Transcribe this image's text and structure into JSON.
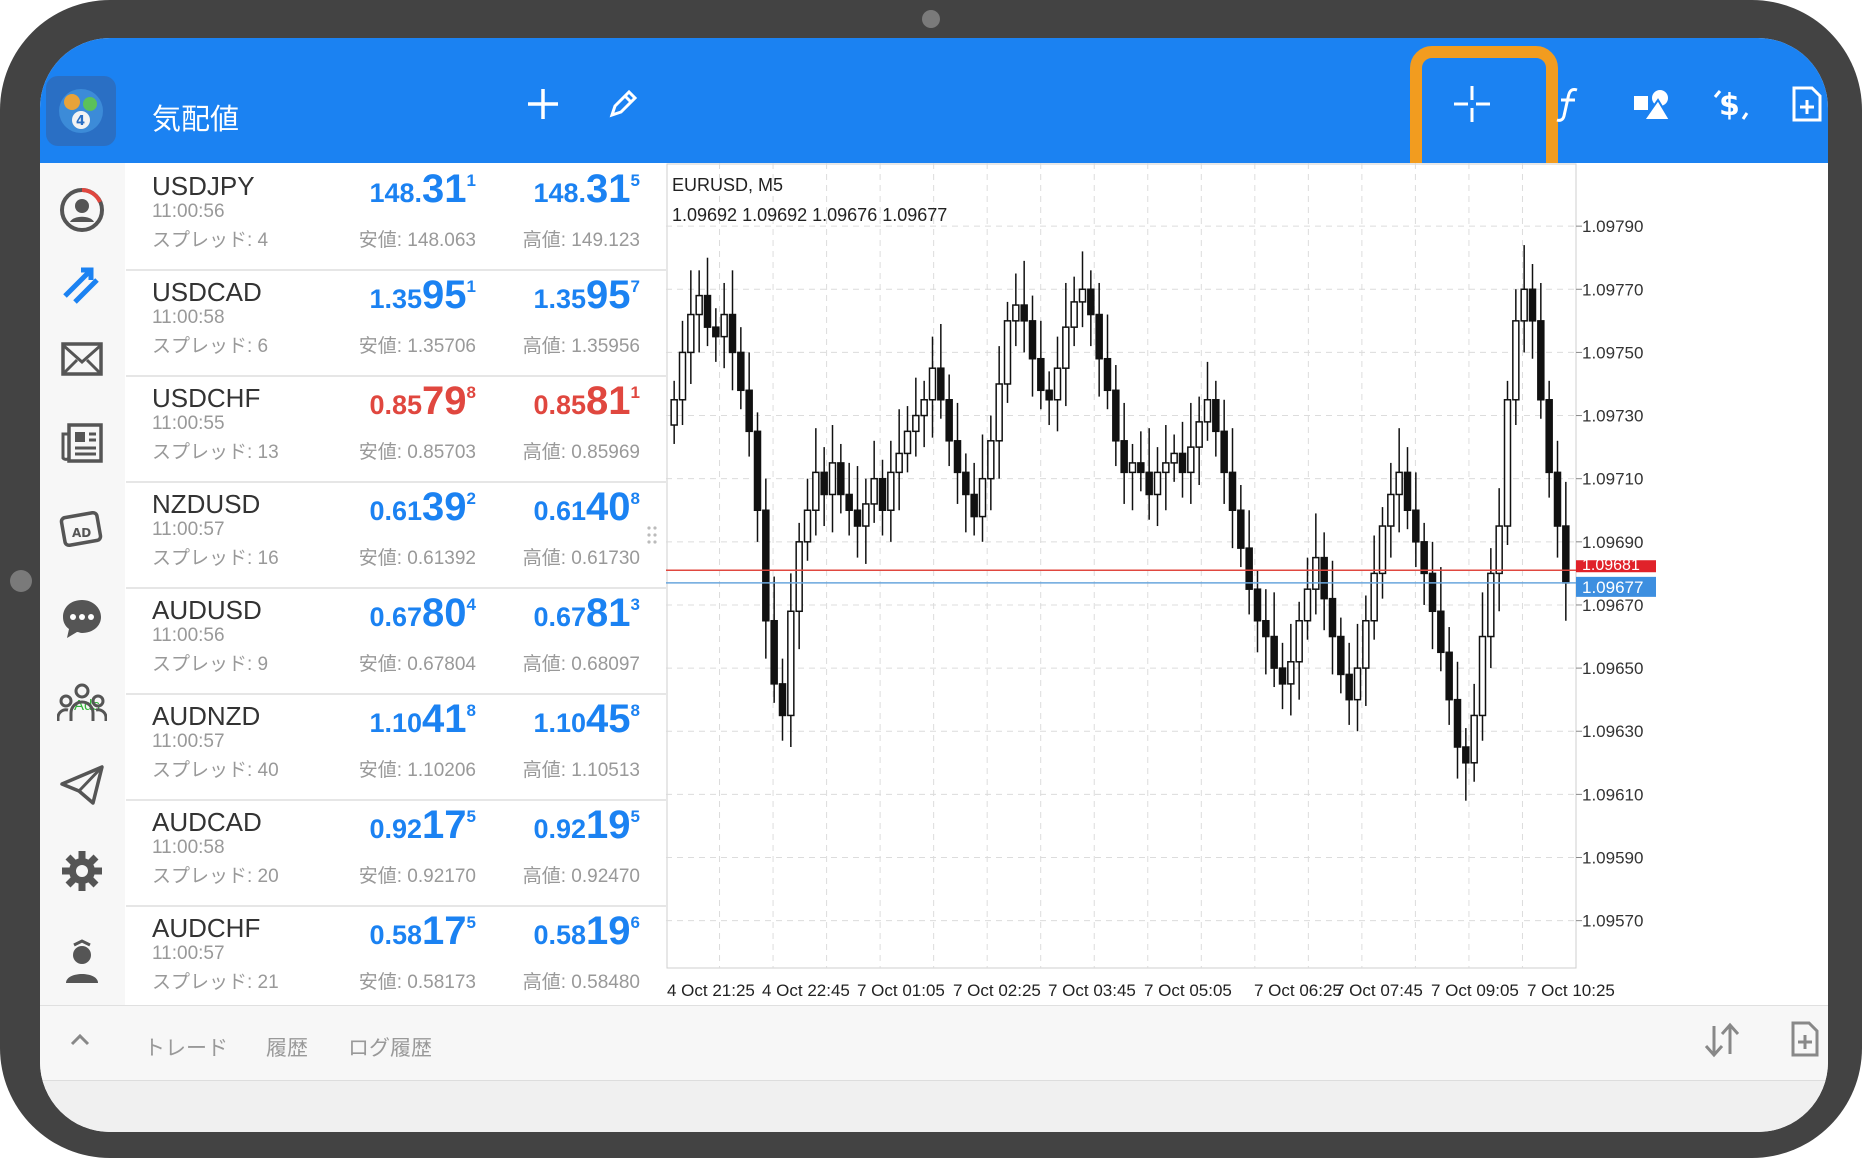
{
  "app": {
    "title": "気配値"
  },
  "toolbar": {
    "icons": [
      "plus-icon",
      "pencil-icon",
      "crosshair-icon",
      "function-icon",
      "shapes-icon",
      "dollar-signal-icon",
      "new-order-icon"
    ]
  },
  "sidebar": {
    "icons": [
      "account-icon",
      "trade-icon",
      "mail-icon",
      "news-icon",
      "ads-icon",
      "chat-icon",
      "community-icon",
      "telegram-icon",
      "settings-icon",
      "traders-icon"
    ],
    "ads_label": "Ads"
  },
  "quotes": [
    {
      "symbol": "USDJPY",
      "time": "11:00:56",
      "spread": "スプレッド: 4",
      "bid": {
        "prefix": "148.",
        "big": "31",
        "sup": "1"
      },
      "ask": {
        "prefix": "148.",
        "big": "31",
        "sup": "5"
      },
      "low": "安値: 148.063",
      "high": "高値: 149.123",
      "color": "blue"
    },
    {
      "symbol": "USDCAD",
      "time": "11:00:58",
      "spread": "スプレッド: 6",
      "bid": {
        "prefix": "1.35",
        "big": "95",
        "sup": "1"
      },
      "ask": {
        "prefix": "1.35",
        "big": "95",
        "sup": "7"
      },
      "low": "安値: 1.35706",
      "high": "高値: 1.35956",
      "color": "blue"
    },
    {
      "symbol": "USDCHF",
      "time": "11:00:55",
      "spread": "スプレッド: 13",
      "bid": {
        "prefix": "0.85",
        "big": "79",
        "sup": "8"
      },
      "ask": {
        "prefix": "0.85",
        "big": "81",
        "sup": "1"
      },
      "low": "安値: 0.85703",
      "high": "高値: 0.85969",
      "color": "red"
    },
    {
      "symbol": "NZDUSD",
      "time": "11:00:57",
      "spread": "スプレッド: 16",
      "bid": {
        "prefix": "0.61",
        "big": "39",
        "sup": "2"
      },
      "ask": {
        "prefix": "0.61",
        "big": "40",
        "sup": "8"
      },
      "low": "安値: 0.61392",
      "high": "高値: 0.61730",
      "color": "blue"
    },
    {
      "symbol": "AUDUSD",
      "time": "11:00:56",
      "spread": "スプレッド: 9",
      "bid": {
        "prefix": "0.67",
        "big": "80",
        "sup": "4"
      },
      "ask": {
        "prefix": "0.67",
        "big": "81",
        "sup": "3"
      },
      "low": "安値: 0.67804",
      "high": "高値: 0.68097",
      "color": "blue"
    },
    {
      "symbol": "AUDNZD",
      "time": "11:00:57",
      "spread": "スプレッド: 40",
      "bid": {
        "prefix": "1.10",
        "big": "41",
        "sup": "8"
      },
      "ask": {
        "prefix": "1.10",
        "big": "45",
        "sup": "8"
      },
      "low": "安値: 1.10206",
      "high": "高値: 1.10513",
      "color": "blue"
    },
    {
      "symbol": "AUDCAD",
      "time": "11:00:58",
      "spread": "スプレッド: 20",
      "bid": {
        "prefix": "0.92",
        "big": "17",
        "sup": "5"
      },
      "ask": {
        "prefix": "0.92",
        "big": "19",
        "sup": "5"
      },
      "low": "安値: 0.92170",
      "high": "高値: 0.92470",
      "color": "blue"
    },
    {
      "symbol": "AUDCHF",
      "time": "11:00:57",
      "spread": "スプレッド: 21",
      "bid": {
        "prefix": "0.58",
        "big": "17",
        "sup": "5"
      },
      "ask": {
        "prefix": "0.58",
        "big": "19",
        "sup": "6"
      },
      "low": "安値: 0.58173",
      "high": "高値: 0.58480",
      "color": "blue"
    }
  ],
  "chart": {
    "symbol": "EURUSD, M5",
    "ohlc": "1.09692 1.09692 1.09676 1.09677",
    "ask_line": "1.09681",
    "bid_line": "1.09677"
  },
  "chart_data": {
    "type": "candlestick",
    "title": "EURUSD, M5",
    "y_ticks": [
      "1.09790",
      "1.09770",
      "1.09750",
      "1.09730",
      "1.09710",
      "1.09690",
      "1.09670",
      "1.09650",
      "1.09630",
      "1.09610",
      "1.09590",
      "1.09570"
    ],
    "x_ticks": [
      "4 Oct 21:25",
      "4 Oct 22:45",
      "7 Oct 01:05",
      "7 Oct 02:25",
      "7 Oct 03:45",
      "7 Oct 05:05",
      "7 Oct 06:25",
      "7 Oct 07:45",
      "7 Oct 09:05",
      "7 Oct 10:25"
    ],
    "ylim": [
      1.09555,
      1.0981
    ],
    "closes": [
      1.09735,
      1.0975,
      1.09762,
      1.09768,
      1.09758,
      1.09755,
      1.09762,
      1.0975,
      1.09738,
      1.09725,
      1.097,
      1.09665,
      1.09645,
      1.09635,
      1.09668,
      1.0969,
      1.097,
      1.09712,
      1.09705,
      1.09715,
      1.09705,
      1.097,
      1.09695,
      1.09702,
      1.0971,
      1.097,
      1.09712,
      1.09718,
      1.09725,
      1.0973,
      1.09735,
      1.09745,
      1.09735,
      1.09722,
      1.09712,
      1.09705,
      1.09698,
      1.0971,
      1.09722,
      1.0974,
      1.0976,
      1.09765,
      1.0976,
      1.09748,
      1.09738,
      1.09735,
      1.09745,
      1.09758,
      1.09766,
      1.0977,
      1.09762,
      1.09748,
      1.09738,
      1.09722,
      1.09712,
      1.09715,
      1.09712,
      1.09705,
      1.09712,
      1.09715,
      1.09718,
      1.09712,
      1.0972,
      1.09728,
      1.09735,
      1.09725,
      1.09712,
      1.097,
      1.09688,
      1.09675,
      1.09665,
      1.0966,
      1.0965,
      1.09645,
      1.09652,
      1.09665,
      1.09675,
      1.09685,
      1.09672,
      1.0966,
      1.09648,
      1.0964,
      1.0965,
      1.09665,
      1.0968,
      1.09695,
      1.09705,
      1.09712,
      1.097,
      1.0969,
      1.0968,
      1.09668,
      1.09655,
      1.0964,
      1.09625,
      1.0962,
      1.09635,
      1.0966,
      1.0968,
      1.09695,
      1.09735,
      1.0976,
      1.0977,
      1.0976,
      1.09735,
      1.09712,
      1.09695,
      1.09677
    ]
  },
  "bottom": {
    "tabs": [
      "トレード",
      "履歴",
      "ログ履歴"
    ]
  }
}
